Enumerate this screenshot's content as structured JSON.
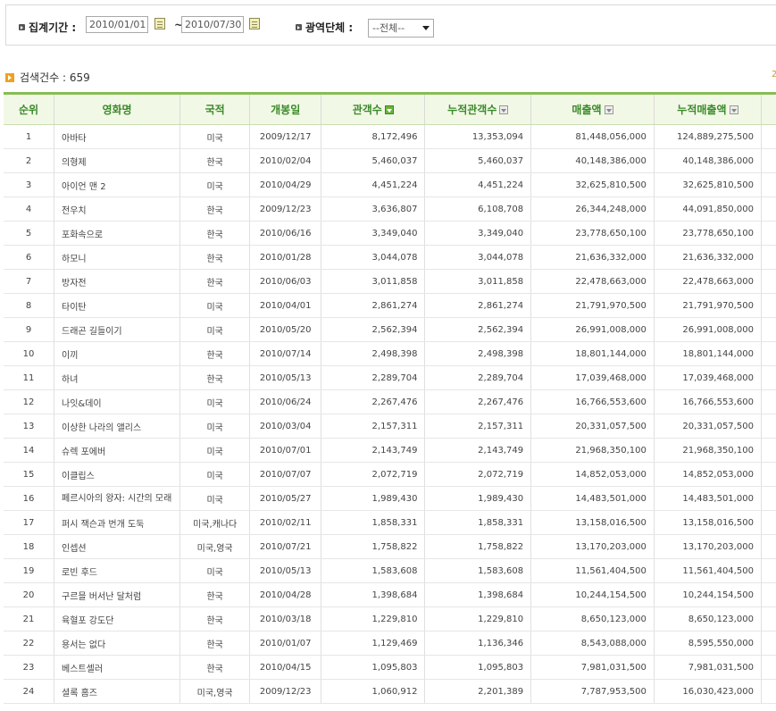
{
  "filters": {
    "period_label": "집계기간 :",
    "date_from": "2010/01/01",
    "tilde": "~",
    "date_to": "2010/07/30",
    "region_label": "광역단체 :",
    "region_value": "--전체--"
  },
  "result_count": "검색건수 : 659",
  "corner_mark": "2",
  "table": {
    "headers": [
      "순위",
      "영화명",
      "국적",
      "개봉일",
      "관객수",
      "누적관객수",
      "매출액",
      "누적매출액"
    ],
    "rows": [
      [
        "1",
        "아바타",
        "미국",
        "2009/12/17",
        "8,172,496",
        "13,353,094",
        "81,448,056,000",
        "124,889,275,500"
      ],
      [
        "2",
        "의형제",
        "한국",
        "2010/02/04",
        "5,460,037",
        "5,460,037",
        "40,148,386,000",
        "40,148,386,000"
      ],
      [
        "3",
        "아이언 맨 2",
        "미국",
        "2010/04/29",
        "4,451,224",
        "4,451,224",
        "32,625,810,500",
        "32,625,810,500"
      ],
      [
        "4",
        "전우치",
        "한국",
        "2009/12/23",
        "3,636,807",
        "6,108,708",
        "26,344,248,000",
        "44,091,850,000"
      ],
      [
        "5",
        "포화속으로",
        "한국",
        "2010/06/16",
        "3,349,040",
        "3,349,040",
        "23,778,650,100",
        "23,778,650,100"
      ],
      [
        "6",
        "하모니",
        "한국",
        "2010/01/28",
        "3,044,078",
        "3,044,078",
        "21,636,332,000",
        "21,636,332,000"
      ],
      [
        "7",
        "방자전",
        "한국",
        "2010/06/03",
        "3,011,858",
        "3,011,858",
        "22,478,663,000",
        "22,478,663,000"
      ],
      [
        "8",
        "타이탄",
        "미국",
        "2010/04/01",
        "2,861,274",
        "2,861,274",
        "21,791,970,500",
        "21,791,970,500"
      ],
      [
        "9",
        "드래곤 길들이기",
        "미국",
        "2010/05/20",
        "2,562,394",
        "2,562,394",
        "26,991,008,000",
        "26,991,008,000"
      ],
      [
        "10",
        "이끼",
        "한국",
        "2010/07/14",
        "2,498,398",
        "2,498,398",
        "18,801,144,000",
        "18,801,144,000"
      ],
      [
        "11",
        "하녀",
        "한국",
        "2010/05/13",
        "2,289,704",
        "2,289,704",
        "17,039,468,000",
        "17,039,468,000"
      ],
      [
        "12",
        "나잇&데이",
        "미국",
        "2010/06/24",
        "2,267,476",
        "2,267,476",
        "16,766,553,600",
        "16,766,553,600"
      ],
      [
        "13",
        "이상한 나라의 앨리스",
        "미국",
        "2010/03/04",
        "2,157,311",
        "2,157,311",
        "20,331,057,500",
        "20,331,057,500"
      ],
      [
        "14",
        "슈렉 포에버",
        "미국",
        "2010/07/01",
        "2,143,749",
        "2,143,749",
        "21,968,350,100",
        "21,968,350,100"
      ],
      [
        "15",
        "이클립스",
        "미국",
        "2010/07/07",
        "2,072,719",
        "2,072,719",
        "14,852,053,000",
        "14,852,053,000"
      ],
      [
        "16",
        "페르시아의 왕자: 시간의 모래",
        "미국",
        "2010/05/27",
        "1,989,430",
        "1,989,430",
        "14,483,501,000",
        "14,483,501,000"
      ],
      [
        "17",
        "퍼시 잭슨과 번개 도둑",
        "미국,캐나다",
        "2010/02/11",
        "1,858,331",
        "1,858,331",
        "13,158,016,500",
        "13,158,016,500"
      ],
      [
        "18",
        "인셉션",
        "미국,영국",
        "2010/07/21",
        "1,758,822",
        "1,758,822",
        "13,170,203,000",
        "13,170,203,000"
      ],
      [
        "19",
        "로빈 후드",
        "미국",
        "2010/05/13",
        "1,583,608",
        "1,583,608",
        "11,561,404,500",
        "11,561,404,500"
      ],
      [
        "20",
        "구르믈 버서난 달처럼",
        "한국",
        "2010/04/28",
        "1,398,684",
        "1,398,684",
        "10,244,154,500",
        "10,244,154,500"
      ],
      [
        "21",
        "육혈포 강도단",
        "한국",
        "2010/03/18",
        "1,229,810",
        "1,229,810",
        "8,650,123,000",
        "8,650,123,000"
      ],
      [
        "22",
        "용서는 없다",
        "한국",
        "2010/01/07",
        "1,129,469",
        "1,136,346",
        "8,543,088,000",
        "8,595,550,000"
      ],
      [
        "23",
        "베스트셀러",
        "한국",
        "2010/04/15",
        "1,095,803",
        "1,095,803",
        "7,981,031,500",
        "7,981,031,500"
      ],
      [
        "24",
        "셜록 홈즈",
        "미국,영국",
        "2009/12/23",
        "1,060,912",
        "2,201,389",
        "7,787,953,500",
        "16,030,423,000"
      ]
    ]
  }
}
